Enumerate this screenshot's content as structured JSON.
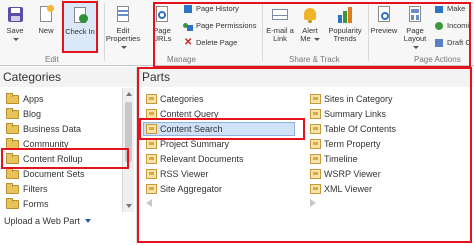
{
  "ribbon": {
    "edit_group": {
      "label": "Edit",
      "save": "Save",
      "new": "New",
      "check_in": "Check In"
    },
    "manage_group": {
      "label": "Manage",
      "edit_properties": [
        "Edit",
        "Properties"
      ],
      "page_urls": [
        "Page",
        "URLs"
      ],
      "page_history": "Page History",
      "page_permissions": "Page Permissions",
      "delete_page": "Delete Page"
    },
    "share_group": {
      "label": "Share & Track",
      "email_link": [
        "E-mail a",
        "Link"
      ],
      "alert_me": [
        "Alert",
        "Me"
      ],
      "popularity_trends": [
        "Popularity",
        "Trends"
      ]
    },
    "page_actions_group": {
      "label": "Page Actions",
      "preview": "Preview",
      "page_layout": [
        "Page",
        "Layout"
      ],
      "make": "Make",
      "incoming": "Incomi",
      "draft_check": "Draft C"
    }
  },
  "categories": {
    "title": "Categories",
    "items": [
      "Apps",
      "Blog",
      "Business Data",
      "Community",
      "Content Rollup",
      "Document Sets",
      "Filters",
      "Forms"
    ],
    "selected": "Content Rollup",
    "upload_label": "Upload a Web Part"
  },
  "parts": {
    "title": "Parts",
    "col1": [
      "Categories",
      "Content Query",
      "Content Search",
      "Project Summary",
      "Relevant Documents",
      "RSS Viewer",
      "Site Aggregator"
    ],
    "col2": [
      "Sites in Category",
      "Summary Links",
      "Table Of Contents",
      "Term Property",
      "Timeline",
      "WSRP Viewer",
      "XML Viewer"
    ],
    "selected": "Content Search"
  },
  "colors": {
    "highlight_red": "#e3131b",
    "selection_blue": "#cfe2f8",
    "folder_yellow": "#e8c35a"
  }
}
